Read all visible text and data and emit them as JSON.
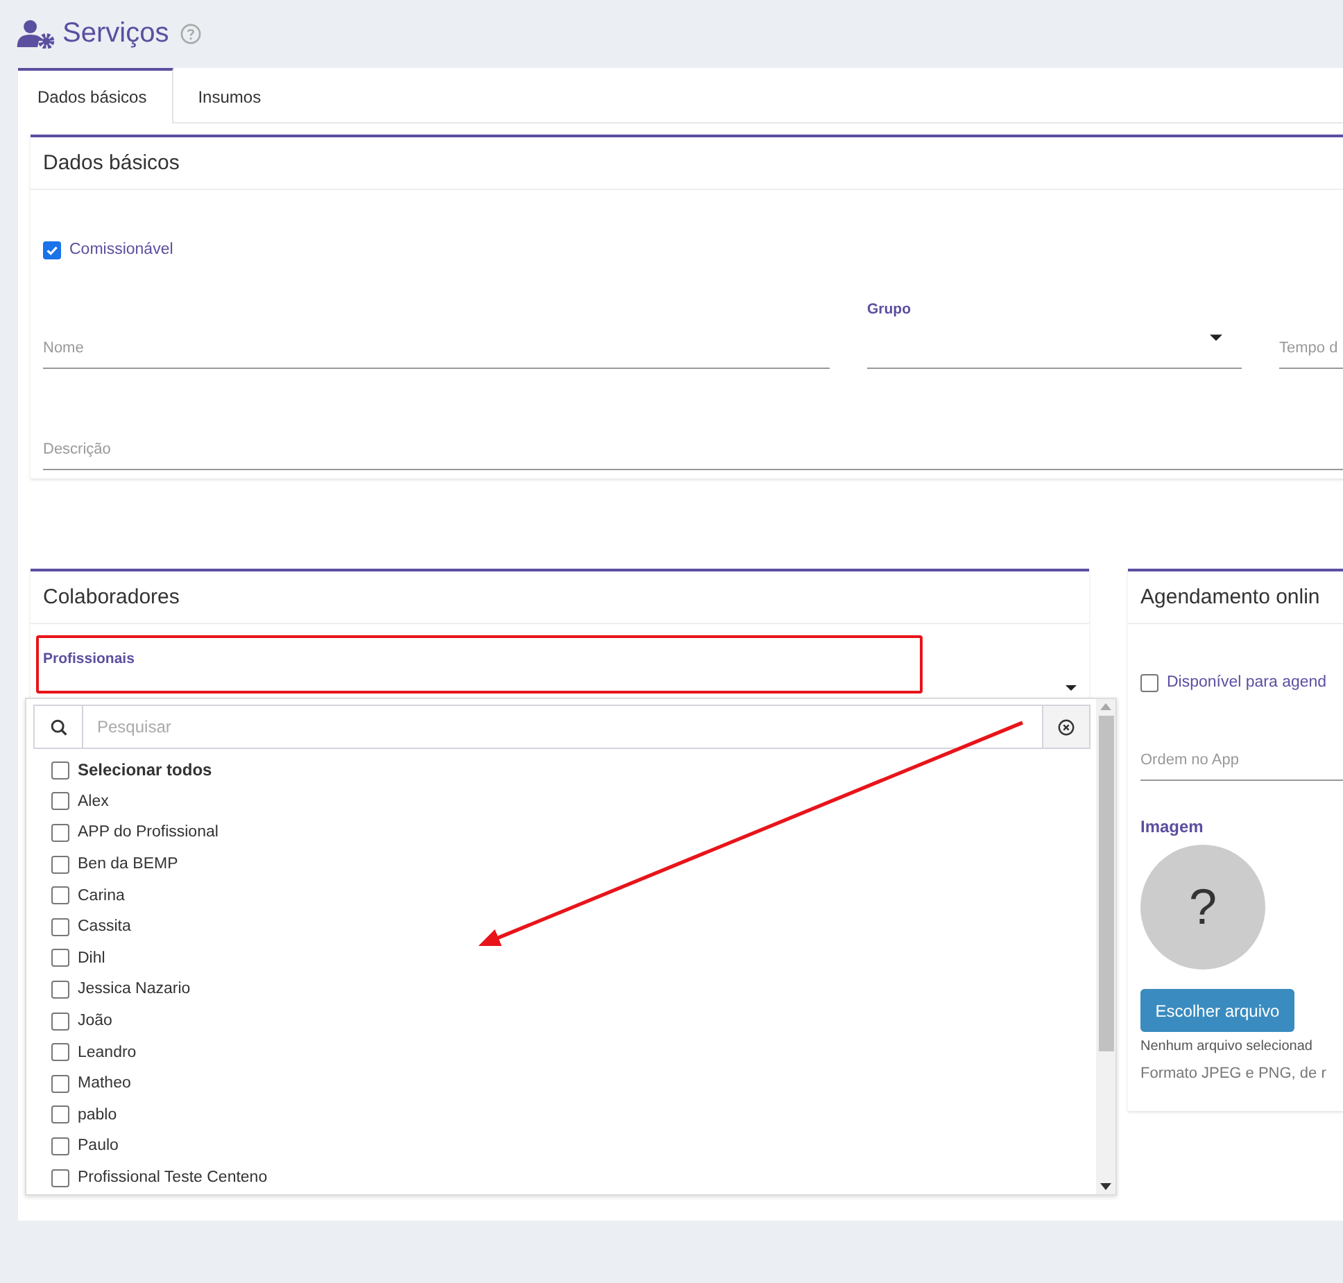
{
  "page": {
    "title": "Serviços"
  },
  "tabs": [
    {
      "label": "Dados básicos",
      "selected": true
    },
    {
      "label": "Insumos",
      "selected": false
    }
  ],
  "basic": {
    "title": "Dados básicos",
    "commission": {
      "label": "Comissionável",
      "checked": true
    },
    "fields": [
      {
        "label": "Nome",
        "kind": "text"
      },
      {
        "label": "Grupo",
        "kind": "select"
      },
      {
        "label": "Tempo d",
        "kind": "text"
      }
    ],
    "description": {
      "label": "Descrição"
    }
  },
  "collaborators": {
    "title": "Colaboradores",
    "field_label": "Profissionais",
    "dropdown": {
      "search_placeholder": "Pesquisar",
      "select_all": {
        "label": "Selecionar todos",
        "checked": false
      },
      "options": [
        {
          "label": "Alex",
          "checked": false
        },
        {
          "label": "APP do Profissional",
          "checked": false
        },
        {
          "label": "Ben da BEMP",
          "checked": false
        },
        {
          "label": "Carina",
          "checked": false
        },
        {
          "label": "Cassita",
          "checked": false
        },
        {
          "label": "Dihl",
          "checked": false
        },
        {
          "label": "Jessica Nazario",
          "checked": false
        },
        {
          "label": "João",
          "checked": false
        },
        {
          "label": "Leandro",
          "checked": false
        },
        {
          "label": "Matheo",
          "checked": false
        },
        {
          "label": "pablo",
          "checked": false
        },
        {
          "label": "Paulo",
          "checked": false
        },
        {
          "label": "Profissional Teste Centeno",
          "checked": false
        }
      ]
    }
  },
  "online": {
    "title": "Agendamento onlin",
    "available": {
      "label": "Disponível para agend",
      "checked": false
    },
    "order_field": {
      "label": "Ordem no App"
    },
    "image": {
      "label": "Imagem",
      "glyph": "?",
      "button": "Escolher arquivo",
      "file_status": "Nenhum arquivo selecionad",
      "hint": "Formato JPEG e PNG, de r"
    }
  }
}
